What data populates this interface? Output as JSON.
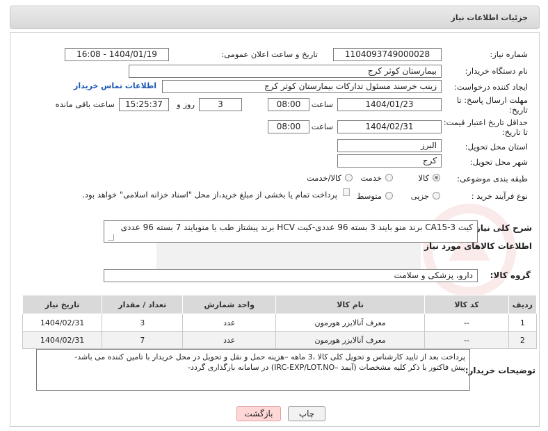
{
  "header": {
    "title": "جزئیات اطلاعات نیاز"
  },
  "form": {
    "need_number_label": "شماره نیاز:",
    "need_number": "1104093749000028",
    "announce_label": "تاریخ و ساعت اعلان عمومی:",
    "announce_value": "1404/01/19 - 16:08",
    "buyer_org_label": "نام دستگاه خریدار:",
    "buyer_org": "بیمارستان کوثر کرج",
    "creator_label": "ایجاد کننده درخواست:",
    "creator": "زینب خرسند مسئول تداركات بیمارستان كوثر كرج",
    "contact_link": "اطلاعات تماس خریدار",
    "deadline_label_1": "مهلت ارسال پاسخ: تا",
    "deadline_label_2": "تاریخ:",
    "deadline_date": "1404/01/23",
    "time_label": "ساعت",
    "deadline_time": "08:00",
    "days": "3",
    "days_label": "روز و",
    "remaining_time": "15:25:37",
    "remaining_label": "ساعت باقی مانده",
    "price_valid_label_1": "حداقل تاریخ اعتبار قیمت:",
    "price_valid_label_2": "تا تاریخ:",
    "price_valid_date": "1404/02/31",
    "price_valid_time": "08:00",
    "province_label": "استان محل تحویل:",
    "province": "البرز",
    "city_label": "شهر محل تحویل:",
    "city": "کرج",
    "category_label": "طبقه بندی موضوعی:",
    "category_options": [
      "کالا",
      "خدمت",
      "کالا/خدمت"
    ],
    "process_label": "نوع فرآیند خرید :",
    "process_options": [
      "جزیی",
      "متوسط"
    ],
    "payment_note": "پرداخت تمام یا بخشی از مبلغ خرید،از محل \"اسناد خزانه اسلامی\" خواهد بود.",
    "summary_label": "شرح کلی نیاز:",
    "summary": "کیت CA15-3 برند منو بایند 3 بسته 96 عددی-کیت HCV  برند پیشتاز طب یا منوبایند 7 بسته 96 عددی",
    "goods_info_title": "اطلاعات کالاهای مورد نیاز",
    "goods_group_label": "گروه کالا:",
    "goods_group": "دارو، پزشکی و سلامت",
    "buyer_notes_label": "توضیحات خریدار:",
    "buyer_notes_line1": "پرداخت بعد از تایید کارشناس و تحویل کلی کالا ،3 ماهه –هزینه حمل و نقل و تحویل در محل خریدار با تامین کننده می باشد-",
    "buyer_notes_line2": "پیش فاکتور با ذکر کلیه مشخصات (آیمد –IRC-EXP/LOT.NO) در سامانه بارگذاری گردد-"
  },
  "table": {
    "headers": [
      "ردیف",
      "کد کالا",
      "نام کالا",
      "واحد شمارش",
      "تعداد / مقدار",
      "تاریخ نیاز"
    ],
    "rows": [
      [
        "1",
        "--",
        "معرف آنالایزر هورمون",
        "عدد",
        "3",
        "1404/02/31"
      ],
      [
        "2",
        "--",
        "معرف آنالایزر هورمون",
        "عدد",
        "7",
        "1404/02/31"
      ]
    ]
  },
  "buttons": {
    "print": "چاپ",
    "back": "بازگشت"
  },
  "colors": {
    "link": "#1a57b3",
    "back_button": "#ffd7d7",
    "table_header": "#d9d9d9"
  }
}
